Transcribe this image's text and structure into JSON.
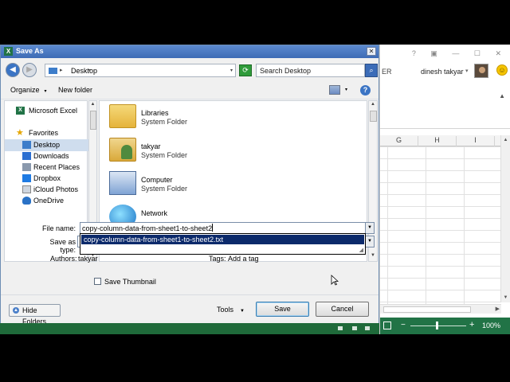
{
  "dialog": {
    "title": "Save As",
    "close_label": "✕",
    "address": {
      "location": "Desktop",
      "separator": "▸",
      "dropdown": "▾"
    },
    "search": {
      "placeholder": "Search Desktop"
    },
    "toolbar": {
      "organize_label": "Organize",
      "new_folder_label": "New folder",
      "caret": "▾"
    },
    "nav": {
      "items": [
        {
          "label": "Microsoft Excel"
        },
        {
          "label": "Favorites"
        },
        {
          "label": "Desktop"
        },
        {
          "label": "Downloads"
        },
        {
          "label": "Recent Places"
        },
        {
          "label": "Dropbox"
        },
        {
          "label": "iCloud Photos"
        },
        {
          "label": "OneDrive"
        }
      ]
    },
    "files": [
      {
        "name": "Libraries",
        "type": "System Folder"
      },
      {
        "name": "takyar",
        "type": "System Folder"
      },
      {
        "name": "Computer",
        "type": "System Folder"
      },
      {
        "name": "Network",
        "type": ""
      }
    ],
    "file_name": {
      "label": "File name:",
      "value": "copy-column-data-from-sheet1-to-sheet2",
      "suggestion": "copy-column-data-from-sheet1-to-sheet2.txt"
    },
    "save_as_type": {
      "label": "Save as type:"
    },
    "authors": {
      "label": "Authors:",
      "value": "takyar"
    },
    "tags": {
      "label": "Tags:",
      "value": "Add a tag"
    },
    "save_thumbnail": {
      "label": "Save Thumbnail",
      "checked": false
    },
    "hide_folders_label": "Hide Folders",
    "tools_label": "Tools",
    "save_label": "Save",
    "cancel_label": "Cancel"
  },
  "excel": {
    "window_controls": "? ▣ — ☐ ✕",
    "ribbon_fragment": "ER",
    "user_name": "dinesh takyar",
    "columns": [
      "G",
      "H",
      "I"
    ],
    "zoom": "100%",
    "colors": {
      "excel_green": "#217346"
    }
  },
  "icons": [
    "excel-icon",
    "star-icon",
    "folder-icon",
    "search-icon",
    "refresh-icon",
    "help-icon",
    "smiley-icon"
  ]
}
